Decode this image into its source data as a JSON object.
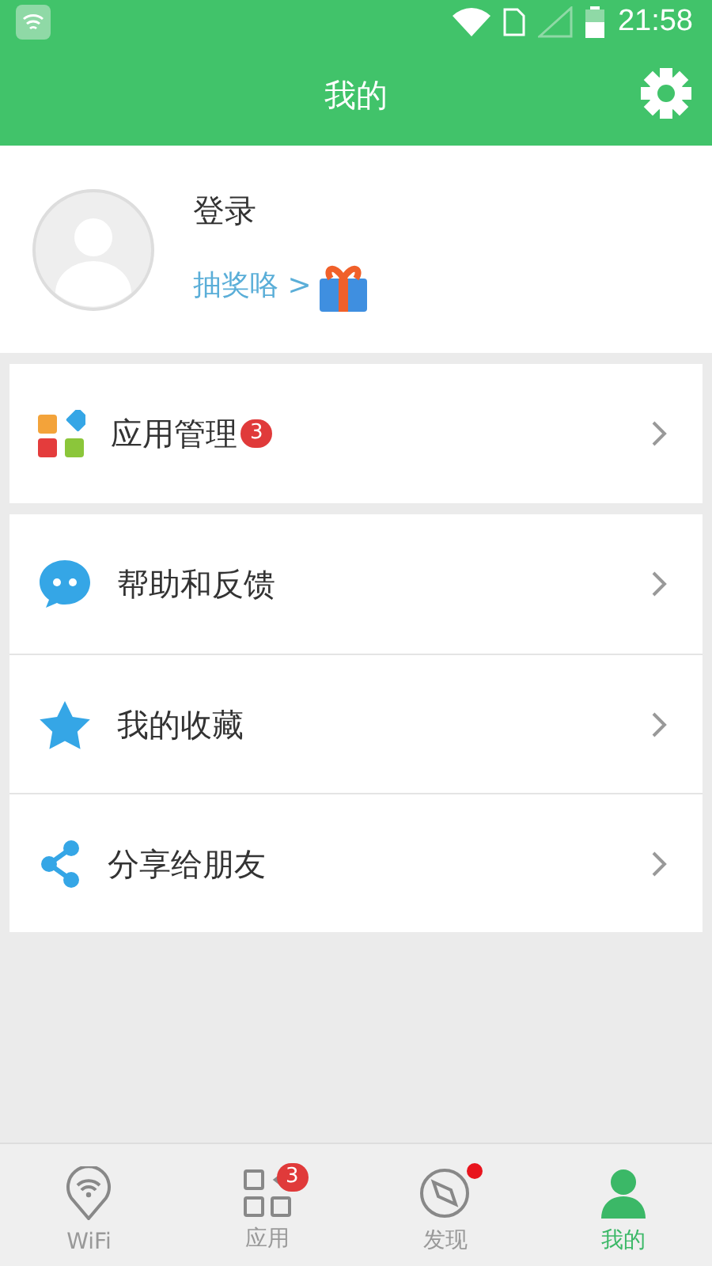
{
  "status_bar": {
    "time": "21:58"
  },
  "header": {
    "title": "我的"
  },
  "profile": {
    "login": "登录",
    "lottery_link": "抽奖咯 >"
  },
  "menu_groups": [
    {
      "items": [
        {
          "kind": "apps",
          "label": "应用管理",
          "badge": "3"
        }
      ]
    },
    {
      "items": [
        {
          "kind": "chat",
          "label": "帮助和反馈"
        },
        {
          "kind": "star",
          "label": "我的收藏"
        },
        {
          "kind": "share",
          "label": "分享给朋友"
        }
      ]
    }
  ],
  "tabs": [
    {
      "kind": "wifi",
      "label": "WiFi",
      "selected": false
    },
    {
      "kind": "apps",
      "label": "应用",
      "badge": "3",
      "selected": false
    },
    {
      "kind": "compass",
      "label": "发现",
      "dot": true,
      "selected": false
    },
    {
      "kind": "person",
      "label": "我的",
      "selected": true
    }
  ]
}
